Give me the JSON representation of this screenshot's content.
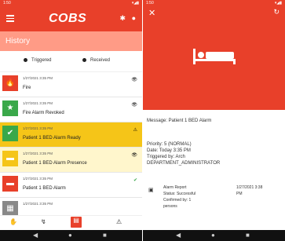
{
  "left_screen": {
    "status_time": "1:50",
    "brand": "COBS",
    "title": "History",
    "filters": [
      "Triggered",
      "Received"
    ],
    "rows": [
      {
        "time": "1/27/2021 3:35 PM",
        "label": "Fire",
        "color": "#e8402a",
        "icon": "fire-icon",
        "state": "eye"
      },
      {
        "time": "1/27/2021 3:35 PM",
        "label": "Fire Alarm Revoked",
        "color": "#3aa84a",
        "icon": "star-icon",
        "state": "eye"
      },
      {
        "time": "1/27/2021 3:35 PM",
        "label": "Patient 1 BED Alarm Ready",
        "color": "#3aa84a",
        "icon": "check-icon",
        "state": "alarm"
      },
      {
        "time": "1/27/2021 3:35 PM",
        "label": "Patient 1 BED Alarm Presence",
        "color": "#f5c518",
        "icon": "bed-icon",
        "state": "eye"
      },
      {
        "time": "1/27/2021 3:35 PM",
        "label": "Patient 1 BED Alarm",
        "color": "#e8402a",
        "icon": "bed-icon",
        "state": "check"
      },
      {
        "time": "1/27/2021 3:35 PM",
        "label": "",
        "color": "#888888",
        "icon": "grid-icon",
        "state": ""
      }
    ]
  },
  "right_screen": {
    "status_time": "1:50",
    "message": "Message: Patient 1 BED Alarm",
    "priority": "Priority: 5 (NORMAL)",
    "date": "Date: Today 3:35 PM",
    "triggered_by": "Triggered by: Arch",
    "department": "DEPARTMENT_ADMINISTRATOR",
    "report_title": "Alarm Report",
    "report_status": "Status: Successful",
    "report_confirmed": "Confirmed by: 1",
    "report_persons": "persons",
    "report_date": "1/27/2021 3:38",
    "report_ampm": "PM"
  },
  "colors": {
    "accent": "#e8402a",
    "history_bar": "#ff9b86"
  }
}
